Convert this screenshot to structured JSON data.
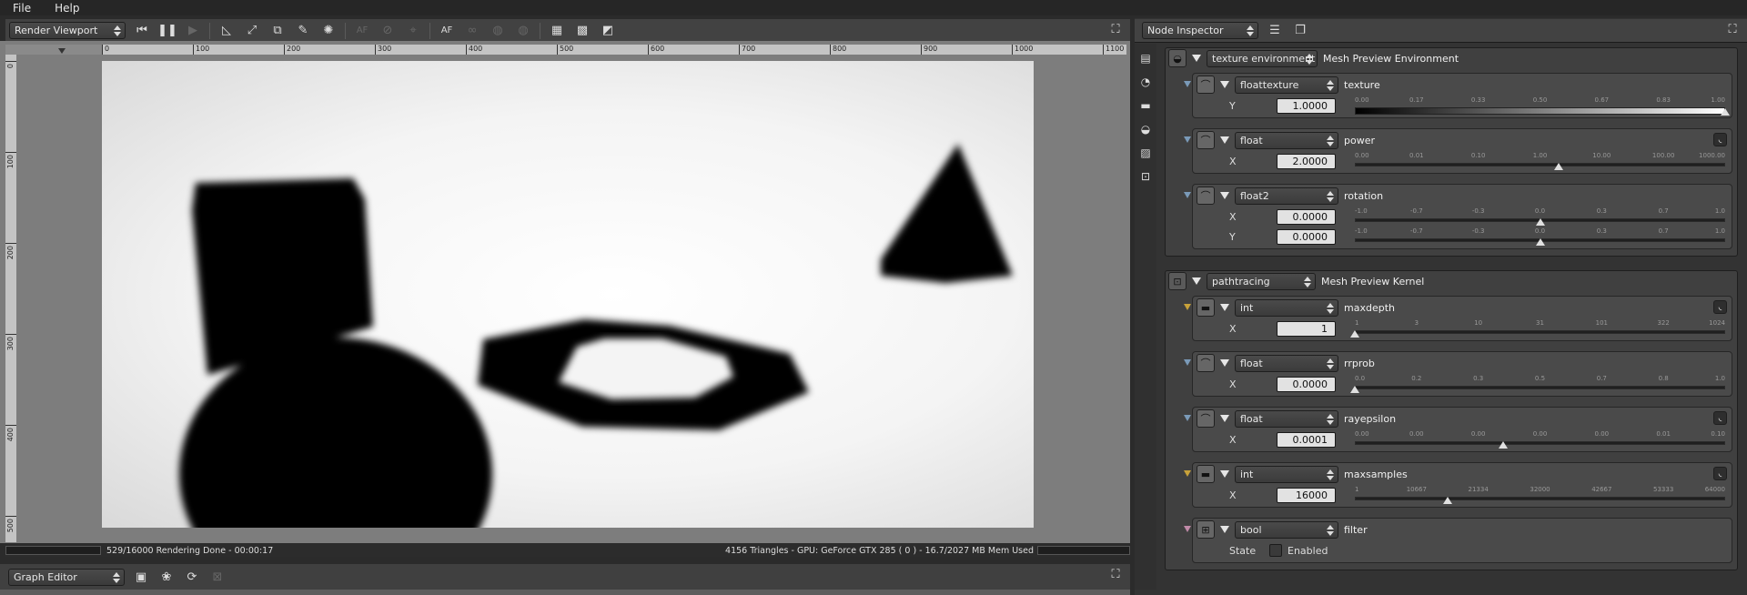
{
  "menubar": {
    "items": [
      "File",
      "Help"
    ]
  },
  "viewport": {
    "mode": "Render Viewport",
    "toolbar": [
      {
        "icon": "skip-start-icon",
        "text": "⏮",
        "dim": false
      },
      {
        "icon": "pause-icon",
        "text": "❚❚",
        "dim": false
      },
      {
        "icon": "play-icon",
        "text": "▶",
        "dim": true
      },
      {
        "icon": "ruler-icon",
        "text": "◺",
        "dim": false
      },
      {
        "icon": "resize-icon",
        "text": "⤢",
        "dim": false
      },
      {
        "icon": "screenshot-icon",
        "text": "⧉",
        "dim": false
      },
      {
        "icon": "material-pick-icon",
        "text": "✎",
        "dim": false
      },
      {
        "icon": "light-pick-icon",
        "text": "✺",
        "dim": false
      },
      {
        "icon": "af-dim-icon",
        "text": "AF",
        "dim": true
      },
      {
        "icon": "focus-icon",
        "text": "⊘",
        "dim": true
      },
      {
        "icon": "camera-target-icon",
        "text": "⌖",
        "dim": true
      },
      {
        "icon": "autofocus-icon",
        "text": "AF",
        "dim": false
      },
      {
        "icon": "link-icon",
        "text": "∞",
        "dim": true
      },
      {
        "icon": "sphere-icon",
        "text": "◍",
        "dim": true
      },
      {
        "icon": "sphere2-icon",
        "text": "◍",
        "dim": true
      },
      {
        "icon": "grid-icon",
        "text": "▦",
        "dim": false
      },
      {
        "icon": "checker-icon",
        "text": "▩",
        "dim": false
      },
      {
        "icon": "region-icon",
        "text": "◩",
        "dim": false
      }
    ],
    "ruler_h": [
      "0",
      "100",
      "200",
      "300",
      "400",
      "500",
      "600",
      "700",
      "800",
      "900",
      "1000",
      "1100"
    ],
    "ruler_v": [
      "0",
      "100",
      "200",
      "300",
      "400",
      "500"
    ],
    "status_left": "529/16000 Rendering Done - 00:00:17",
    "status_right": "4156 Triangles - GPU: GeForce GTX 285 ( 0 ) - 16.7/2027 MB Mem Used"
  },
  "inspector": {
    "title": "Node Inspector",
    "env": {
      "type": "texture environment",
      "label": "Mesh Preview Environment"
    },
    "env_params": [
      {
        "type": "floattexture",
        "name": "texture",
        "pin": "#7a9ab8",
        "rows": [
          {
            "axis": "Y",
            "value": "1.0000"
          }
        ],
        "gradient": true,
        "ticks": [
          "0.00",
          "0.17",
          "0.33",
          "0.50",
          "0.67",
          "0.83",
          "1.00"
        ],
        "fraction": 1.0,
        "curve": false
      },
      {
        "type": "float",
        "name": "power",
        "pin": "#7a9ab8",
        "rows": [
          {
            "axis": "X",
            "value": "2.0000"
          }
        ],
        "ticks": [
          "0.00",
          "0.01",
          "0.10",
          "1.00",
          "10.00",
          "100.00",
          "1000.00"
        ],
        "fraction": 0.55,
        "curve": true
      },
      {
        "type": "float2",
        "name": "rotation",
        "pin": "#7a9ab8",
        "rows": [
          {
            "axis": "X",
            "value": "0.0000",
            "fraction": 0.5
          },
          {
            "axis": "Y",
            "value": "0.0000",
            "fraction": 0.5
          }
        ],
        "ticks": [
          "-1.0",
          "-0.7",
          "-0.3",
          "0.0",
          "0.3",
          "0.7",
          "1.0"
        ],
        "curve": false
      }
    ],
    "kernel": {
      "type": "pathtracing",
      "label": "Mesh Preview Kernel"
    },
    "kernel_params": [
      {
        "type": "int",
        "name": "maxdepth",
        "pin": "#c8a23a",
        "rows": [
          {
            "axis": "X",
            "value": "1"
          }
        ],
        "ticks": [
          "1",
          "3",
          "10",
          "31",
          "101",
          "322",
          "1024"
        ],
        "fraction": 0.0,
        "curve": true
      },
      {
        "type": "float",
        "name": "rrprob",
        "pin": "#7a9ab8",
        "rows": [
          {
            "axis": "X",
            "value": "0.0000"
          }
        ],
        "ticks": [
          "0.0",
          "0.2",
          "0.3",
          "0.5",
          "0.7",
          "0.8",
          "1.0"
        ],
        "fraction": 0.0,
        "curve": false
      },
      {
        "type": "float",
        "name": "rayepsilon",
        "pin": "#7a9ab8",
        "rows": [
          {
            "axis": "X",
            "value": "0.0001"
          }
        ],
        "ticks": [
          "0.00",
          "0.00",
          "0.00",
          "0.00",
          "0.00",
          "0.01",
          "0.10"
        ],
        "fraction": 0.4,
        "curve": true
      },
      {
        "type": "int",
        "name": "maxsamples",
        "pin": "#c8a23a",
        "rows": [
          {
            "axis": "X",
            "value": "16000"
          }
        ],
        "ticks": [
          "1",
          "10667",
          "21334",
          "32000",
          "42667",
          "53333",
          "64000"
        ],
        "fraction": 0.25,
        "curve": true
      },
      {
        "type": "bool",
        "name": "filter",
        "pin": "#c08aa8",
        "state_label": "State",
        "check_label": "Enabled"
      }
    ]
  },
  "graph_editor": {
    "mode": "Graph Editor"
  }
}
